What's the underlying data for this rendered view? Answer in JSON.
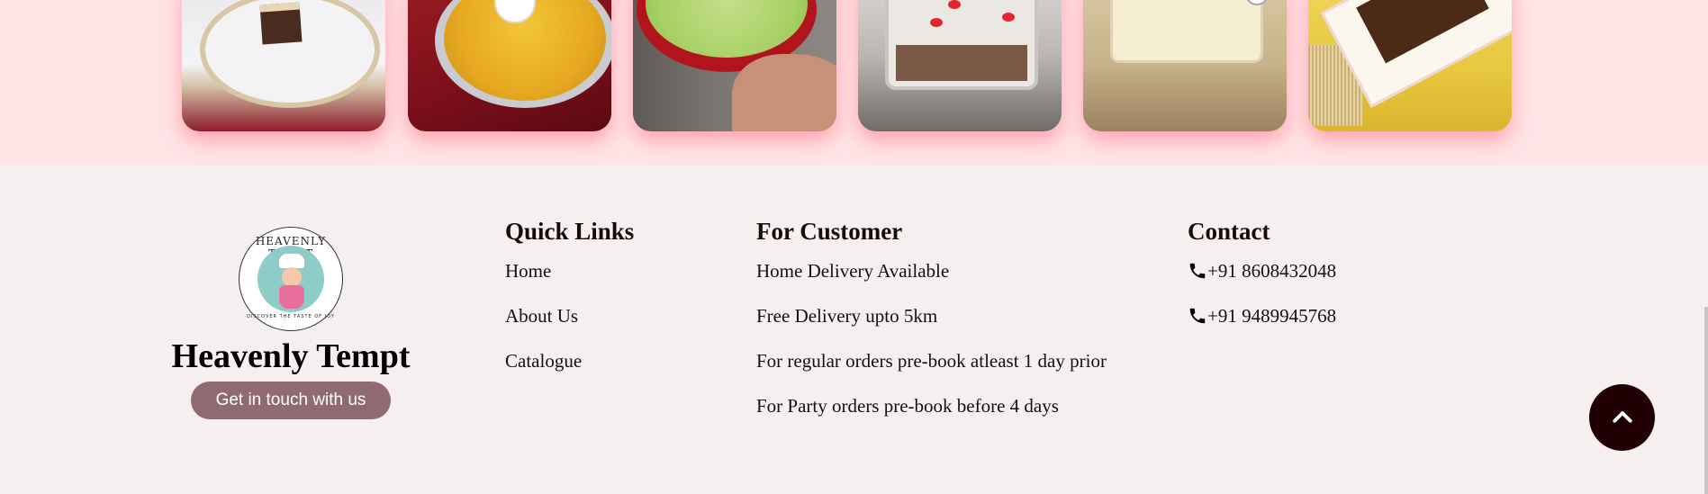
{
  "gallery": {
    "images": [
      {
        "alt": "chocolate-cake-slice-on-plate"
      },
      {
        "alt": "golden-pie-in-tin"
      },
      {
        "alt": "green-frosted-cake-in-tin"
      },
      {
        "alt": "strawberry-dessert-box"
      },
      {
        "alt": "cream-dessert-tub"
      },
      {
        "alt": "brownie-tray"
      }
    ]
  },
  "brand": {
    "logo_ring_text": "HEAVENLY TEMPT",
    "logo_tagline": "DISCOVER THE TASTE OF JOY",
    "name": "Heavenly Tempt",
    "cta_label": "Get in touch with us"
  },
  "quick_links": {
    "title": "Quick Links",
    "items": [
      "Home",
      "About Us",
      "Catalogue"
    ]
  },
  "for_customer": {
    "title": "For Customer",
    "items": [
      "Home Delivery Available",
      "Free Delivery upto 5km",
      "For regular orders pre-book atleast 1 day prior",
      "For Party orders pre-book before 4 days"
    ]
  },
  "contact": {
    "title": "Contact",
    "phones": [
      "+91 8608432048",
      "+91 9489945768"
    ]
  },
  "icons": {
    "phone": "phone-icon",
    "scroll_top": "chevron-up-icon"
  },
  "colors": {
    "gallery_bg": "#ffe4e6",
    "footer_bg": "#f6eff0",
    "cta_bg": "#8f6a72",
    "scroll_top_bg": "#200003"
  }
}
